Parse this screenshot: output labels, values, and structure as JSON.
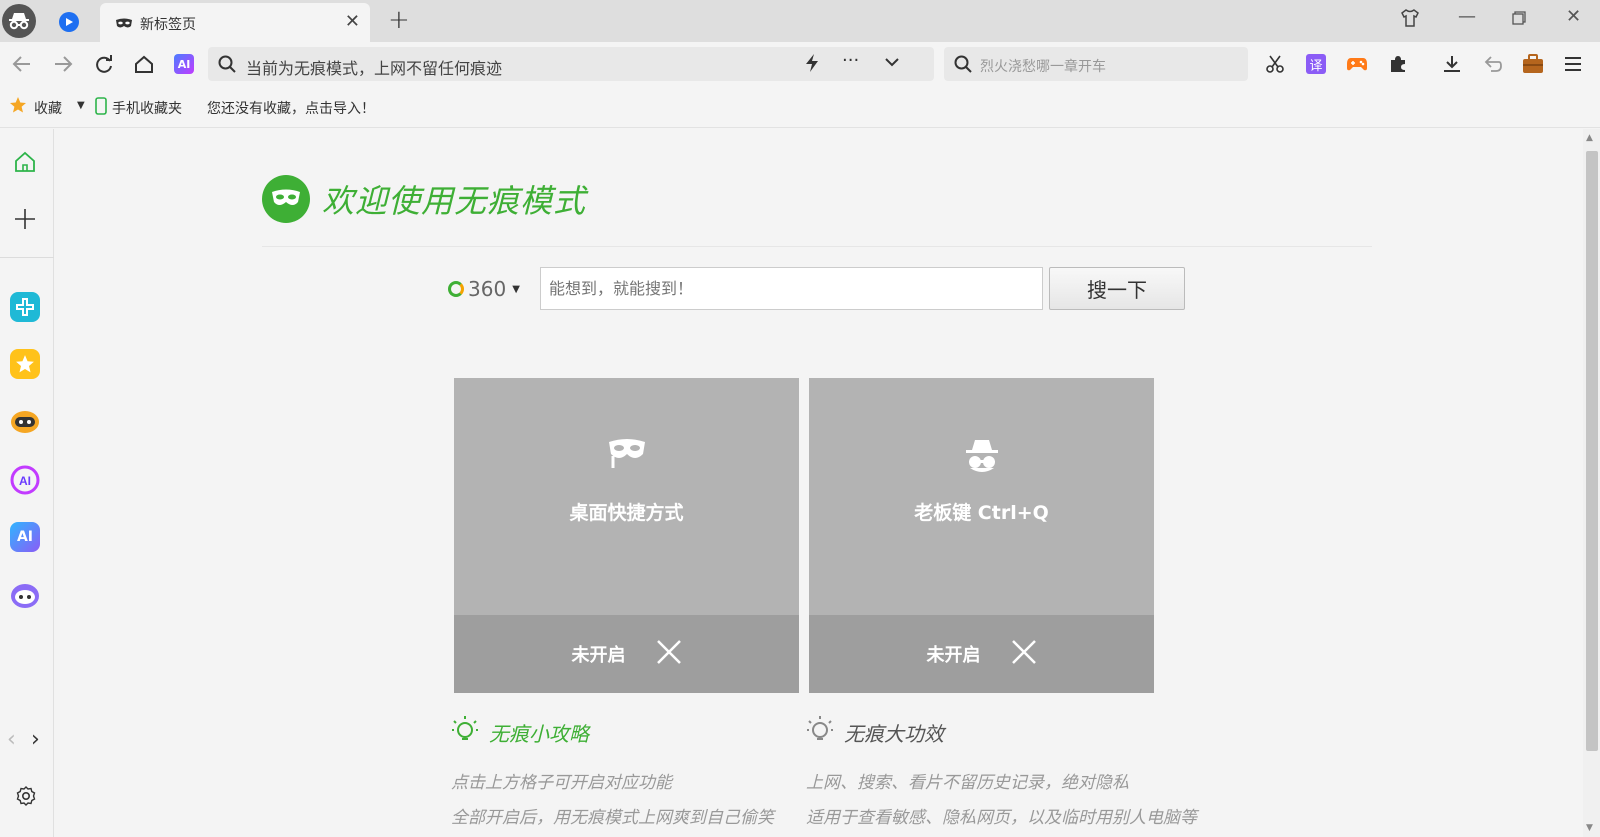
{
  "tab": {
    "title": "新标签页"
  },
  "address": {
    "text": "当前为无痕模式，上网不留任何痕迹"
  },
  "search_box": {
    "placeholder": "烈火浇愁哪一章开车"
  },
  "bookmarks": {
    "fav_label": "收藏",
    "mobile_label": "手机收藏夹",
    "import_hint": "您还没有收藏，点击导入！"
  },
  "main": {
    "welcome_title": "欢迎使用无痕模式",
    "engine_name": "360",
    "search_placeholder": "能想到，就能搜到！",
    "search_button": "搜一下",
    "cards": [
      {
        "label": "桌面快捷方式",
        "state": "未开启"
      },
      {
        "label": "老板键 Ctrl+Q",
        "state": "未开启"
      }
    ],
    "tips_left": {
      "title": "无痕小攻略",
      "lines": [
        "点击上方格子可开启对应功能",
        "全部开启后，用无痕模式上网爽到自己偷笑"
      ]
    },
    "tips_right": {
      "title": "无痕大功效",
      "lines": [
        "上网、搜索、看片不留历史记录，绝对隐私",
        "适用于查看敏感、隐私网页，以及临时用别人电脑等"
      ]
    }
  },
  "colors": {
    "brand_green": "#3eaf35",
    "card_bg": "#b3b3b3",
    "card_footer": "#9e9e9e"
  },
  "icons": [
    "incognito-icon",
    "play-icon",
    "mask-icon",
    "close-icon",
    "plus-icon",
    "shirt-icon",
    "minimize-icon",
    "restore-icon",
    "back-icon",
    "forward-icon",
    "reload-icon",
    "home-icon",
    "ai-icon",
    "search-icon",
    "lightning-icon",
    "more-icon",
    "chevron-down-icon",
    "scissors-icon",
    "translate-icon",
    "game-icon",
    "extension-icon",
    "download-icon",
    "undo-icon",
    "briefcase-icon",
    "menu-icon",
    "star-icon",
    "phone-icon",
    "settings-icon"
  ]
}
